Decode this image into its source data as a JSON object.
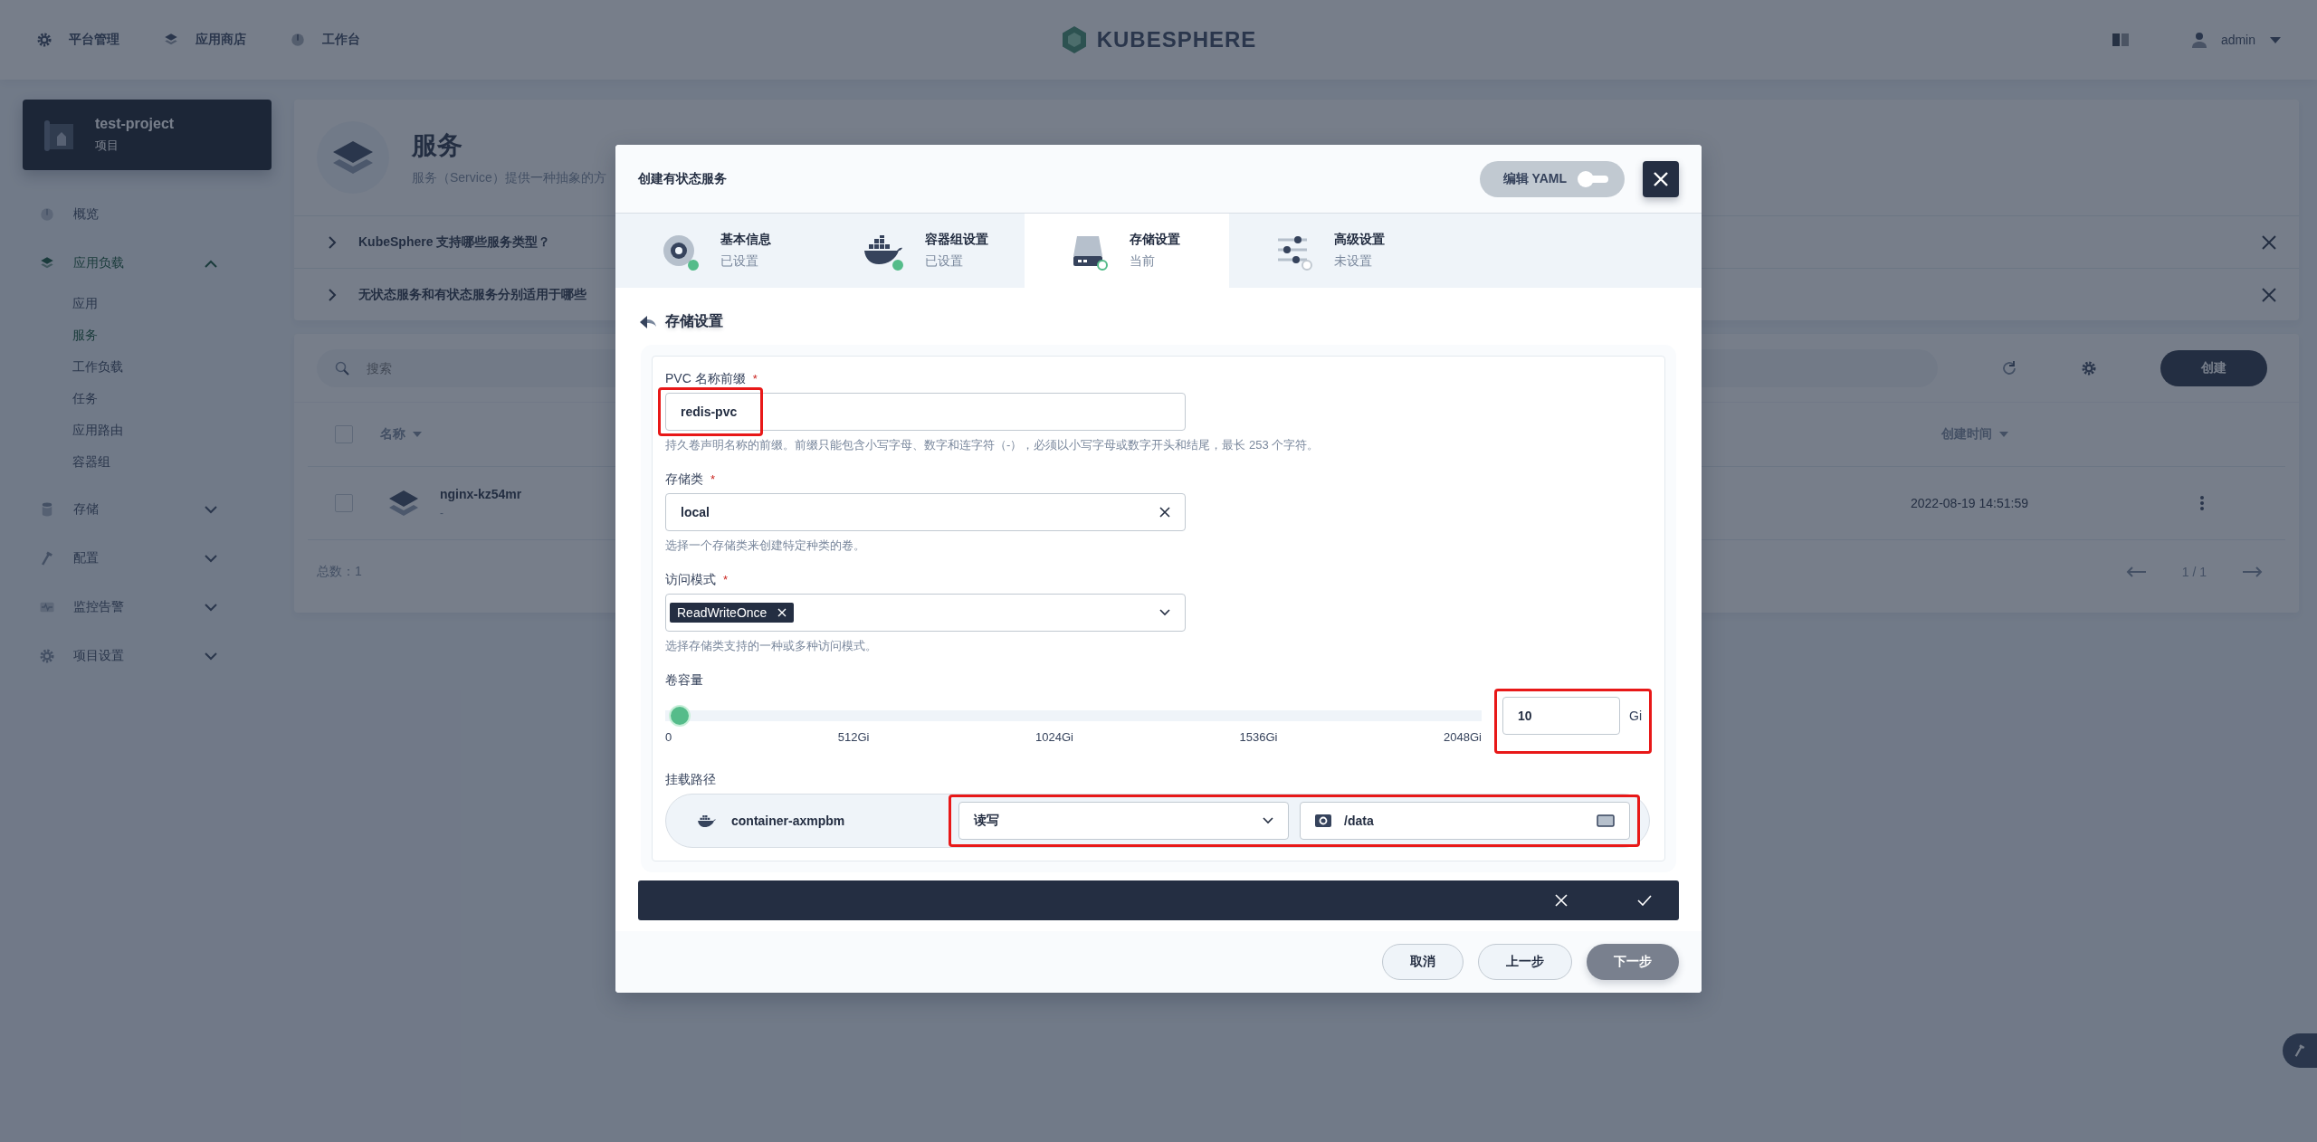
{
  "topbar": {
    "nav": [
      "平台管理",
      "应用商店",
      "工作台"
    ],
    "logo": "KUBESPHERE",
    "user": "admin"
  },
  "project": {
    "name": "test-project",
    "type": "项目"
  },
  "sidebar": {
    "items": [
      {
        "label": "概览",
        "selected": false
      },
      {
        "label": "应用负载",
        "selected": true,
        "expanded": true,
        "children": [
          {
            "label": "应用",
            "selected": false
          },
          {
            "label": "服务",
            "selected": true
          },
          {
            "label": "工作负载",
            "selected": false
          },
          {
            "label": "任务",
            "selected": false
          },
          {
            "label": "应用路由",
            "selected": false
          },
          {
            "label": "容器组",
            "selected": false
          }
        ]
      },
      {
        "label": "存储",
        "selected": false,
        "expanded": false
      },
      {
        "label": "配置",
        "selected": false,
        "expanded": false
      },
      {
        "label": "监控告警",
        "selected": false,
        "expanded": false
      },
      {
        "label": "项目设置",
        "selected": false,
        "expanded": false
      }
    ]
  },
  "page_header": {
    "title": "服务",
    "description": "服务（Service）提供一种抽象的方",
    "faq": [
      "KubeSphere 支持哪些服务类型？",
      "无状态服务和有状态服务分别适用于哪些"
    ]
  },
  "list": {
    "search": {
      "placeholder": "搜索"
    },
    "create_button": "创建",
    "columns": [
      "名称",
      "创建时间"
    ],
    "header_checked": false,
    "rows": [
      {
        "name": "nginx-kz54mr",
        "description": "-",
        "created": "2022-08-19 14:51:59",
        "selected": false
      }
    ],
    "total": "总数：1",
    "page": "1 / 1"
  },
  "modal": {
    "title": "创建有状态服务",
    "yaml_toggle": {
      "label": "编辑 YAML",
      "on": false
    },
    "steps": [
      {
        "title": "基本信息",
        "status": "已设置",
        "done": true,
        "selected": false
      },
      {
        "title": "容器组设置",
        "status": "已设置",
        "done": true,
        "selected": false
      },
      {
        "title": "存储设置",
        "status": "当前",
        "done": false,
        "selected": true
      },
      {
        "title": "高级设置",
        "status": "未设置",
        "done": false,
        "selected": false
      }
    ],
    "section": "存储设置",
    "pvc_prefix": {
      "label": "PVC 名称前缀",
      "required_mark": "*",
      "value": "redis-pvc",
      "hint": "持久卷声明名称的前缀。前缀只能包含小写字母、数字和连字符（-），必须以小写字母或数字开头和结尾，最长 253 个字符。"
    },
    "storage_class": {
      "label": "存储类",
      "required_mark": "*",
      "value": "local",
      "hint": "选择一个存储类来创建特定种类的卷。"
    },
    "access_mode": {
      "label": "访问模式",
      "required_mark": "*",
      "tags": [
        "ReadWriteOnce"
      ],
      "hint": "选择存储类支持的一种或多种访问模式。"
    },
    "capacity": {
      "label": "卷容量",
      "level": 0.005,
      "ticks": [
        "0",
        "512Gi",
        "1024Gi",
        "1536Gi",
        "2048Gi"
      ],
      "value": "10",
      "unit": "Gi"
    },
    "mount": {
      "label": "挂载路径",
      "container": "container-axmpbm",
      "mode": "读写",
      "path": "/data"
    },
    "buttons": [
      {
        "label": "取消",
        "kind": "default",
        "disabled": false
      },
      {
        "label": "上一步",
        "kind": "default",
        "disabled": false
      },
      {
        "label": "下一步",
        "kind": "primary",
        "disabled": true
      }
    ]
  }
}
